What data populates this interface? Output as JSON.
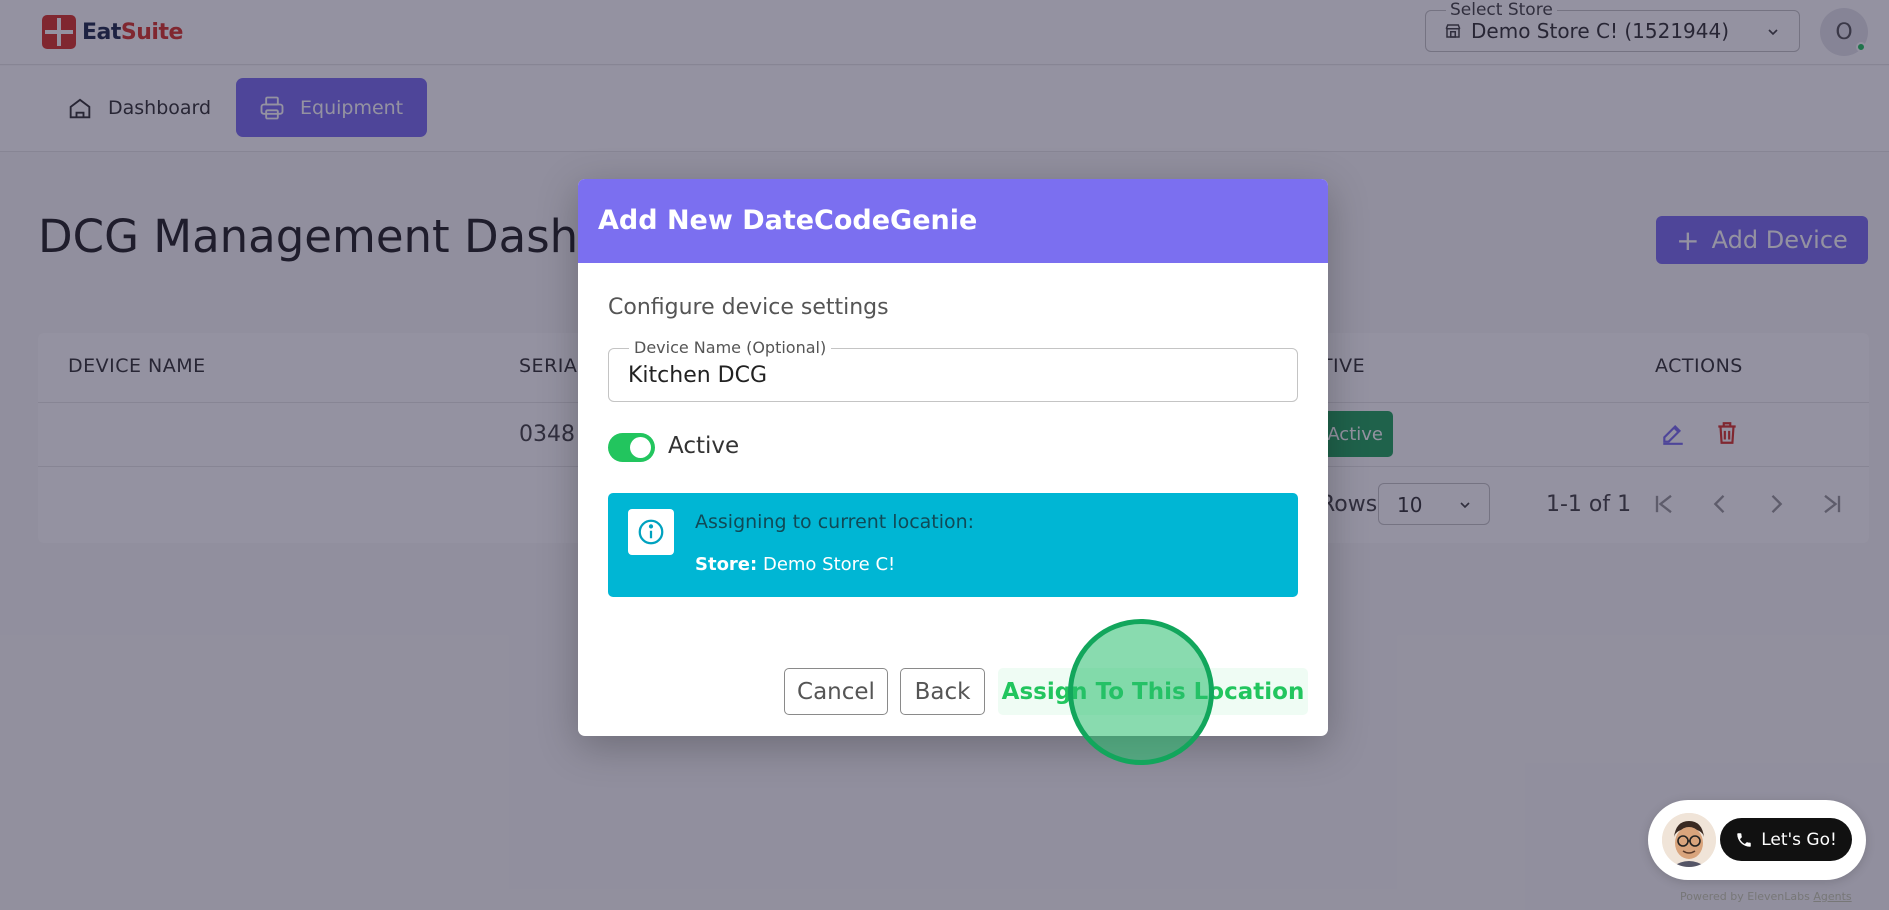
{
  "app": {
    "logo_eat": "Eat",
    "logo_suite": "Suite"
  },
  "header": {
    "store_legend": "Select Store",
    "store_value": "Demo Store C! (1521944)",
    "avatar_initial": "O"
  },
  "nav": {
    "items": [
      {
        "label": "Dashboard",
        "icon": "home-icon",
        "active": false
      },
      {
        "label": "Equipment",
        "icon": "printer-icon",
        "active": true
      }
    ]
  },
  "page": {
    "title": "DCG Management Dashboard",
    "add_device_label": "Add Device"
  },
  "table": {
    "columns": [
      "DEVICE NAME",
      "SERIAL",
      "ACTIVE",
      "ACTIONS"
    ],
    "rows": [
      {
        "device_name": "",
        "serial": "0348",
        "active_label": "Active"
      }
    ],
    "rows_per_page_label": "Rows per page:",
    "rows_per_page_value": "10",
    "page_range": "1-1 of 1"
  },
  "dialog": {
    "title": "Add New DateCodeGenie",
    "subtitle": "Configure device settings",
    "device_name_label": "Device Name (Optional)",
    "device_name_value": "Kitchen DCG",
    "active_label": "Active",
    "active_on": true,
    "info_text": "Assigning to current location:",
    "store_key": "Store:",
    "store_value": "Demo Store C!",
    "cancel_label": "Cancel",
    "back_label": "Back",
    "assign_label": "Assign To This Location"
  },
  "widget": {
    "button_label": "Let's Go!",
    "powered_prefix": "Powered by ElevenLabs",
    "powered_link": "Agents"
  },
  "colors": {
    "accent": "#7b6ff0",
    "success": "#22c55e",
    "info": "#00b6d4",
    "danger": "#d9362b"
  }
}
